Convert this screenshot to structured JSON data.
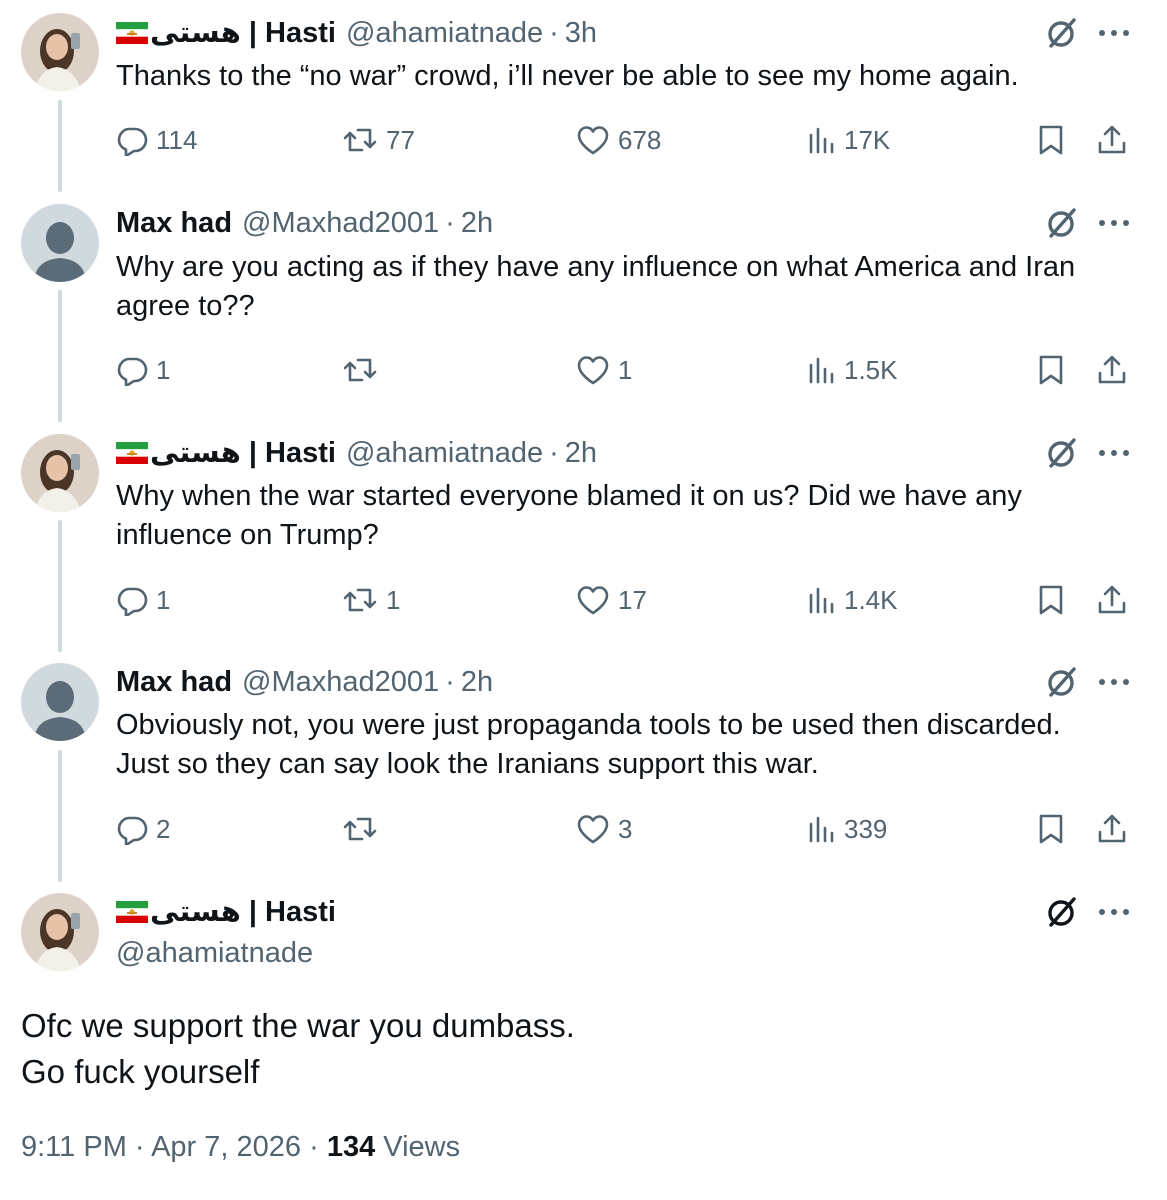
{
  "posts": [
    {
      "display_name_fa": "هستی",
      "separator": " | ",
      "display_name": "Hasti",
      "handle": "@ahamiatnade",
      "dot": "·",
      "time": "3h",
      "text": "Thanks to the “no war” crowd, i’ll never be able to see my home again.",
      "stats": {
        "replies": "114",
        "reposts": "77",
        "likes": "678",
        "views": "17K"
      }
    },
    {
      "display_name": "Max had",
      "handle": "@Maxhad2001",
      "dot": "·",
      "time": "2h",
      "text_lines": [
        "Why are you acting as if they have any influence on what America and Iran",
        "agree to??"
      ],
      "stats": {
        "replies": "1",
        "reposts": "",
        "likes": "1",
        "views": "1.5K"
      }
    },
    {
      "display_name_fa": "هستی",
      "separator": " | ",
      "display_name": "Hasti",
      "handle": "@ahamiatnade",
      "dot": "·",
      "time": "2h",
      "text_lines": [
        "Why when the war started everyone blamed it on us? Did we have any",
        "influence on Trump?"
      ],
      "stats": {
        "replies": "1",
        "reposts": "1",
        "likes": "17",
        "views": "1.4K"
      }
    },
    {
      "display_name": "Max had",
      "handle": "@Maxhad2001",
      "dot": "·",
      "time": "2h",
      "text_lines": [
        "Obviously not, you were just propaganda tools to be used then discarded.",
        "Just so they can say look the Iranians support this war."
      ],
      "stats": {
        "replies": "2",
        "reposts": "",
        "likes": "3",
        "views": "339"
      }
    }
  ],
  "main_post": {
    "display_name_fa": "هستی",
    "separator": " | ",
    "display_name": "Hasti",
    "handle": "@ahamiatnade",
    "text_lines": [
      "Ofc we support the war you dumbass.",
      "Go fuck yourself"
    ],
    "time": "9:11 PM",
    "dot": "·",
    "date": "Apr 7, 2026",
    "view_count": "134",
    "views_label": "Views"
  },
  "icons": {
    "reply": "reply-icon",
    "repost": "repost-icon",
    "like": "heart-icon",
    "views": "views-chart-icon",
    "bookmark": "bookmark-icon",
    "share": "share-icon",
    "grok": "grok-icon",
    "more": "more-dots-icon",
    "flag": "iran-lion-sun-flag-icon"
  },
  "colors": {
    "text": "#0f1419",
    "secondary": "#536471",
    "thread_line": "#cfd9de"
  }
}
